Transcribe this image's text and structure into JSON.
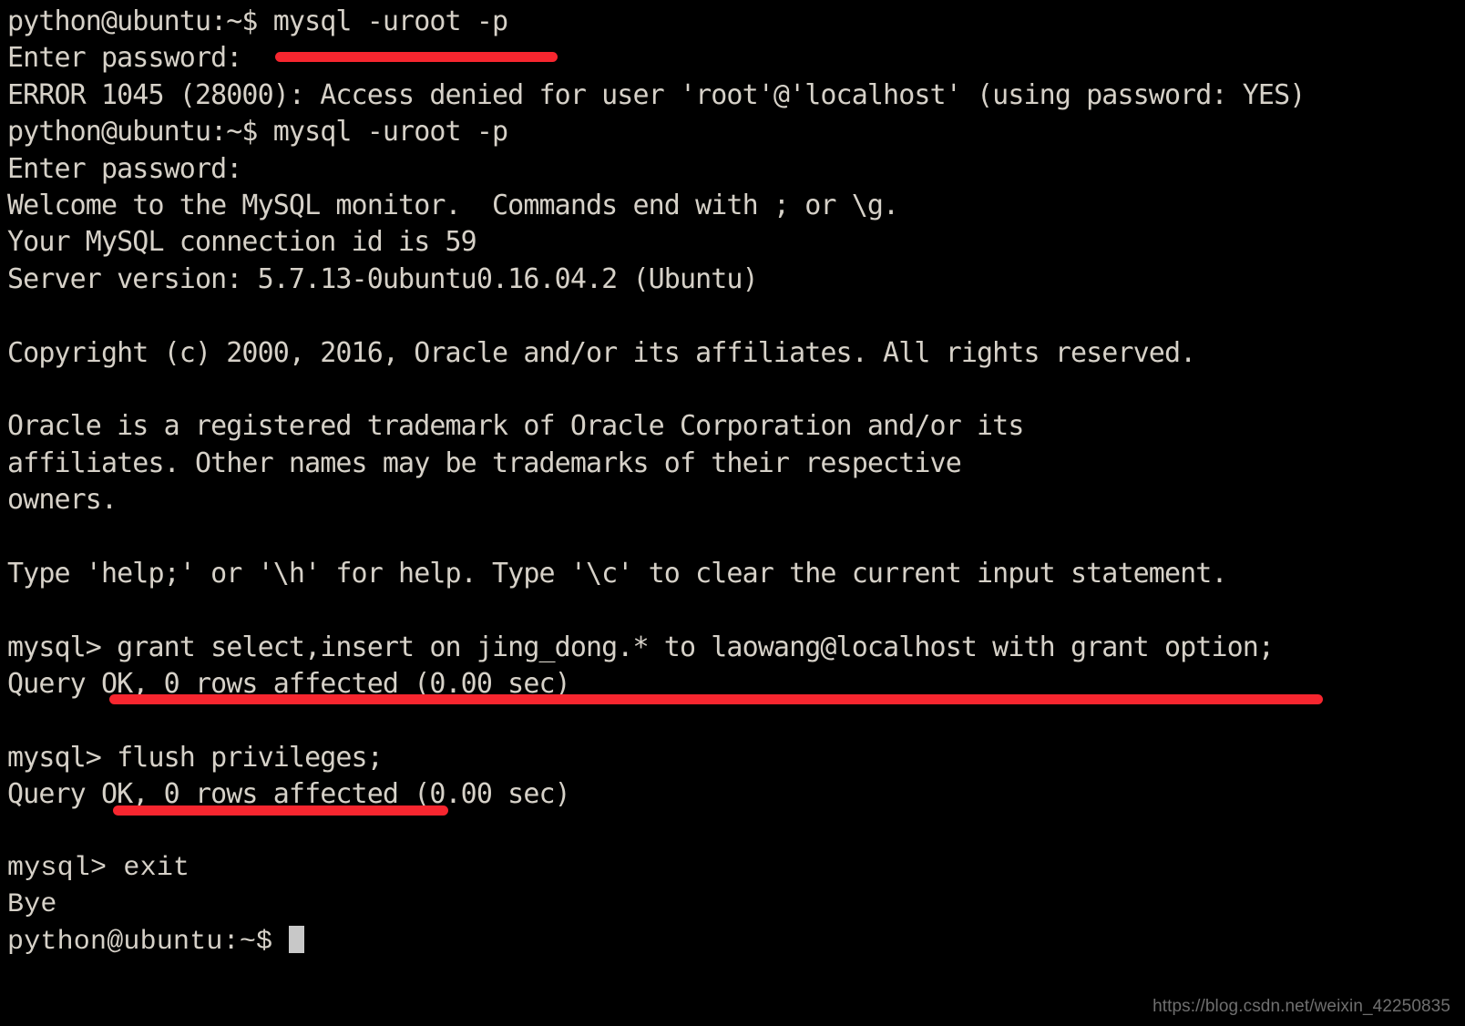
{
  "terminal": {
    "shell_prompt": "python@ubuntu:~$",
    "mysql_prompt": "mysql>",
    "cursor": "block-cursor",
    "lines": [
      {
        "id": "line-1",
        "text": "python@ubuntu:~$ mysql -uroot -p"
      },
      {
        "id": "line-2",
        "text": "Enter password:"
      },
      {
        "id": "line-3",
        "text": "ERROR 1045 (28000): Access denied for user 'root'@'localhost' (using password: YES)"
      },
      {
        "id": "line-4",
        "text": "python@ubuntu:~$ mysql -uroot -p"
      },
      {
        "id": "line-5",
        "text": "Enter password:"
      },
      {
        "id": "line-6",
        "text": "Welcome to the MySQL monitor.  Commands end with ; or \\g."
      },
      {
        "id": "line-7",
        "text": "Your MySQL connection id is 59"
      },
      {
        "id": "line-8",
        "text": "Server version: 5.7.13-0ubuntu0.16.04.2 (Ubuntu)"
      },
      {
        "id": "line-9",
        "text": ""
      },
      {
        "id": "line-10",
        "text": "Copyright (c) 2000, 2016, Oracle and/or its affiliates. All rights reserved."
      },
      {
        "id": "line-11",
        "text": ""
      },
      {
        "id": "line-12",
        "text": "Oracle is a registered trademark of Oracle Corporation and/or its"
      },
      {
        "id": "line-13",
        "text": "affiliates. Other names may be trademarks of their respective"
      },
      {
        "id": "line-14",
        "text": "owners."
      },
      {
        "id": "line-15",
        "text": ""
      },
      {
        "id": "line-16",
        "text": "Type 'help;' or '\\h' for help. Type '\\c' to clear the current input statement."
      },
      {
        "id": "line-17",
        "text": ""
      },
      {
        "id": "line-18",
        "text": "mysql> grant select,insert on jing_dong.* to laowang@localhost with grant option;"
      },
      {
        "id": "line-19",
        "text": "Query OK, 0 rows affected (0.00 sec)"
      },
      {
        "id": "line-20",
        "text": ""
      },
      {
        "id": "line-21",
        "text": "mysql> flush privileges;"
      },
      {
        "id": "line-22",
        "text": "Query OK, 0 rows affected (0.00 sec)"
      },
      {
        "id": "line-23",
        "text": ""
      },
      {
        "id": "line-24",
        "text": "mysql> exit"
      },
      {
        "id": "line-25",
        "text": "Bye"
      },
      {
        "id": "line-26",
        "text": "python@ubuntu:~$ "
      }
    ]
  },
  "annotations": {
    "color": "#f7262f",
    "marks": [
      {
        "id": "redmark-1",
        "target": "password-entry-redaction",
        "note": "Enter password:"
      },
      {
        "id": "redmark-2",
        "target": "grant-statement-underline",
        "note": "grant select,insert on jing_dong.* to laowang@localhost with grant option;"
      },
      {
        "id": "redmark-3",
        "target": "flush-privileges-underline",
        "note": "flush privileges;"
      }
    ]
  },
  "watermark": {
    "text": "https://blog.csdn.net/weixin_42250835"
  }
}
